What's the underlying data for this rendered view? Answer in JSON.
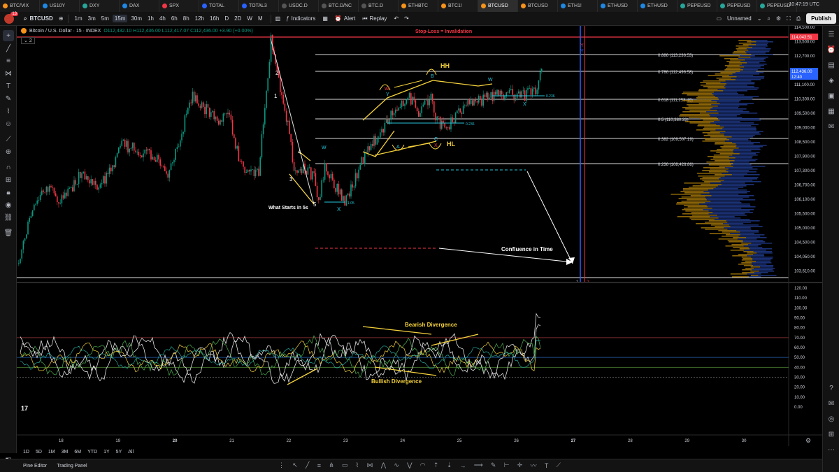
{
  "browser_tabs": [
    {
      "label": "BTC/VIX",
      "color": "#f7931a"
    },
    {
      "label": "US10Y",
      "color": "#1e88e5"
    },
    {
      "label": "DXY",
      "color": "#26a69a"
    },
    {
      "label": "DAX",
      "color": "#1e88e5"
    },
    {
      "label": "SPX",
      "color": "#f23645"
    },
    {
      "label": "TOTAL",
      "color": "#2962ff"
    },
    {
      "label": "TOTAL3",
      "color": "#2962ff"
    },
    {
      "label": "USDC.D",
      "color": "#555555"
    },
    {
      "label": "BTC.D/NC",
      "color": "#555555"
    },
    {
      "label": "BTC.D",
      "color": "#555555"
    },
    {
      "label": "ETHBTC",
      "color": "#f7931a"
    },
    {
      "label": "BTC1!",
      "color": "#f7931a"
    },
    {
      "label": "BTCUSD",
      "color": "#f7931a",
      "active": true
    },
    {
      "label": "BTCUSD",
      "color": "#f7931a"
    },
    {
      "label": "ETH1!",
      "color": "#1e88e5"
    },
    {
      "label": "ETHUSD",
      "color": "#1e88e5"
    },
    {
      "label": "ETHUSD",
      "color": "#1e88e5"
    },
    {
      "label": "PEPEUSD",
      "color": "#26a69a"
    },
    {
      "label": "PEPEUSD",
      "color": "#26a69a"
    },
    {
      "label": "PEPEUSD",
      "color": "#26a69a"
    }
  ],
  "toolbar": {
    "notification_count": "13",
    "symbol": "BTCUSD",
    "intervals": [
      "1m",
      "3m",
      "5m",
      "15m",
      "30m",
      "1h",
      "4h",
      "6h",
      "8h",
      "12h",
      "16h",
      "D",
      "2D",
      "W",
      "M"
    ],
    "active_interval": "15m",
    "indicators_label": "Indicators",
    "alert_label": "Alert",
    "replay_label": "Replay",
    "layout_name": "Unnamed",
    "publish_label": "Publish"
  },
  "legend": {
    "title": "Bitcoin / U.S. Dollar · 15 · INDEX",
    "ohlc": "O112,432.10 H112,436.00 L112,417.07 C112,436.00 +3.90 (+0.00%)",
    "indicator_count": "2"
  },
  "annotations": {
    "stop_loss": "Stop-Loss = Invalidation",
    "hh": "HH",
    "hl": "HL",
    "what_starts": "What Starts in 5s",
    "confluence": "Confluence in Time",
    "bearish_div": "Bearish Divergence",
    "bullish_div": "Bullish Divergence",
    "wave_1": "1",
    "wave_2": "2",
    "wave_3": "3",
    "wave_4": "4",
    "wave_5": "5",
    "w": "W",
    "x": "X",
    "y": "Y",
    "a": "A",
    "b": "B",
    "c": "C",
    "fib_small_1": "0.236",
    "fib_small_2": "0.236",
    "fib_small_3": "1.05",
    "time_marker_1": "1",
    "time_marker_2": "2"
  },
  "fib_levels": [
    {
      "label": "0.886 (113,236.53)",
      "price": 113236.53
    },
    {
      "label": "0.786 (112,496.58)",
      "price": 112496.58
    },
    {
      "label": "0.618 (111,253.46)",
      "price": 111253.46
    },
    {
      "label": "0.5 (110,380.33)",
      "price": 110380.33
    },
    {
      "label": "0.382 (109,507.19)",
      "price": 109507.19
    },
    {
      "label": "0.236 (108,426.86)",
      "price": 108426.86
    }
  ],
  "price_axis": {
    "ticks": [
      "114,500.00",
      "113,500.00",
      "112,700.00",
      "111,900.00",
      "111,100.00",
      "110,300.00",
      "109,500.00",
      "109,000.00",
      "108,500.00",
      "107,900.00",
      "107,300.00",
      "106,700.00",
      "106,100.00",
      "105,500.00",
      "105,000.00",
      "104,500.00",
      "104,050.00",
      "103,610.00"
    ],
    "stop_loss_price": "114,043.51",
    "current_price": "112,436.00",
    "countdown": "12:40"
  },
  "rsi_axis": {
    "ticks": [
      "120.00",
      "110.00",
      "100.00",
      "90.00",
      "80.00",
      "70.00",
      "60.00",
      "50.00",
      "40.00",
      "30.00",
      "20.00",
      "10.00",
      "0.00"
    ]
  },
  "time_axis": {
    "ticks": [
      "18",
      "19",
      "20",
      "21",
      "22",
      "23",
      "24",
      "25",
      "26",
      "27",
      "28",
      "29",
      "30"
    ]
  },
  "bottom": {
    "ranges": [
      "1D",
      "5D",
      "1M",
      "3M",
      "6M",
      "YTD",
      "1Y",
      "5Y",
      "All"
    ],
    "clock": "10:47:19 UTC",
    "pine_editor": "Pine Editor",
    "trading_panel": "Trading Panel"
  },
  "colors": {
    "up": "#089981",
    "down": "#f23645",
    "annotation_yellow": "#f5d23c",
    "stop_line": "#f23645",
    "time_line": "#2962ff",
    "volume_profile_up": "#b8860b",
    "volume_profile_down": "#1e3a8a"
  }
}
